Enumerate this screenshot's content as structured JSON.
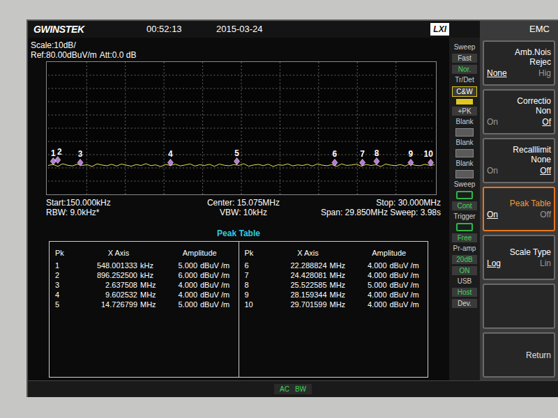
{
  "header": {
    "brand": "GWINSTEK",
    "time": "00:52:13",
    "date": "2015-03-24",
    "lxi": "LXI",
    "mode": "EMC"
  },
  "settings": {
    "scale": "Scale:10dB/",
    "ref": "Ref:80.00dBuV/m",
    "att": "Att:0.0 dB",
    "start": "Start:150.000kHz",
    "center": "Center: 15.075MHz",
    "stop": "Stop: 30.000MHz",
    "rbw": "RBW: 9.0kHz*",
    "vbw": "VBW: 10kHz",
    "span": "Span: 29.850MHz",
    "sweep": "Sweep: 3.98s"
  },
  "chart": {
    "ref_level": 80,
    "div_db": 10,
    "divisions": 10,
    "start_mhz": 0.15,
    "stop_mhz": 30,
    "trace_color": "#e6e65a",
    "marker_color": "#b77ad6",
    "trace": [
      1.8,
      2.6,
      1.2,
      3.1,
      2.0,
      1.5,
      2.8,
      1.9,
      2.4,
      1.1,
      3.0,
      2.2,
      1.6,
      2.7,
      1.4,
      2.9,
      2.1,
      1.3,
      2.5,
      1.8,
      3.2,
      1.7,
      2.3,
      1.0,
      2.6,
      1.9,
      2.8,
      1.5,
      2.2,
      3.0,
      1.4,
      2.4,
      1.8,
      2.7,
      1.2,
      2.9,
      2.0,
      1.6,
      2.5,
      1.9,
      3.1,
      1.3,
      2.2,
      2.6,
      1.7,
      2.8,
      1.1,
      2.4,
      2.0,
      3.0,
      1.5,
      2.3,
      1.8,
      2.7,
      1.4,
      2.9,
      2.1,
      1.6,
      2.5,
      1.2,
      3.0,
      1.9,
      2.2,
      2.8,
      1.3,
      2.6,
      1.8,
      2.4,
      1.0,
      2.9,
      2.1,
      1.7,
      2.5,
      1.4,
      3.1,
      2.0,
      1.6,
      2.7,
      1.9,
      2.3
    ]
  },
  "status_column": [
    {
      "kind": "label",
      "text": "Sweep"
    },
    {
      "kind": "value",
      "text": "Fast",
      "selected": false
    },
    {
      "kind": "value",
      "text": "Nor.",
      "selected": true
    },
    {
      "kind": "label",
      "text": "Tr/Det"
    },
    {
      "kind": "badge",
      "text": "C&W",
      "color": "#e0c820"
    },
    {
      "kind": "swatch",
      "color": "#e0c820"
    },
    {
      "kind": "value",
      "text": "+PK",
      "selected": false
    },
    {
      "kind": "label",
      "text": "Blank"
    },
    {
      "kind": "box"
    },
    {
      "kind": "label",
      "text": "Blank"
    },
    {
      "kind": "box"
    },
    {
      "kind": "label",
      "text": "Blank"
    },
    {
      "kind": "box"
    },
    {
      "kind": "label",
      "text": "Sweep"
    },
    {
      "kind": "icon",
      "color": "#2fb54a"
    },
    {
      "kind": "value",
      "text": "Cont",
      "selected": true
    },
    {
      "kind": "label",
      "text": "Trigger"
    },
    {
      "kind": "icon",
      "color": "#2fb54a"
    },
    {
      "kind": "value",
      "text": "Free",
      "selected": true
    },
    {
      "kind": "label",
      "text": "Pr-amp"
    },
    {
      "kind": "value",
      "text": "20dB",
      "selected": true
    },
    {
      "kind": "value",
      "text": "ON",
      "selected": true
    },
    {
      "kind": "label",
      "text": "USB"
    },
    {
      "kind": "value",
      "text": "Host",
      "selected": true
    },
    {
      "kind": "value",
      "text": "Dev.",
      "selected": false
    }
  ],
  "softkeys": [
    {
      "kind": "choice",
      "title": "Amb.Nois",
      "subtitle": "Rejec",
      "highlighted": false,
      "options": [
        {
          "label": "None",
          "selected": true
        },
        {
          "label": "Hig",
          "selected": false
        }
      ]
    },
    {
      "kind": "choice",
      "title": "Correctio",
      "subtitle": "Non",
      "highlighted": false,
      "options": [
        {
          "label": "On",
          "selected": false
        },
        {
          "label": "Of",
          "selected": true
        }
      ]
    },
    {
      "kind": "choice",
      "title": "Recalllimit",
      "subtitle": "None",
      "highlighted": false,
      "options": [
        {
          "label": "On",
          "selected": false
        },
        {
          "label": "Off",
          "selected": true
        }
      ]
    },
    {
      "kind": "choice",
      "title": "Peak Table",
      "subtitle": "",
      "highlighted": true,
      "options": [
        {
          "label": "On",
          "selected": true
        },
        {
          "label": "Off",
          "selected": false
        }
      ]
    },
    {
      "kind": "choice",
      "title": "Scale Type",
      "subtitle": "",
      "highlighted": false,
      "options": [
        {
          "label": "Log",
          "selected": true
        },
        {
          "label": "Lin",
          "selected": false
        }
      ]
    },
    {
      "kind": "blank",
      "highlighted": false
    },
    {
      "kind": "action",
      "title": "Return",
      "highlighted": false
    }
  ],
  "peak_table": {
    "title": "Peak Table",
    "columns": {
      "pk": "Pk",
      "x": "X Axis",
      "amp": "Amplitude"
    },
    "rows": [
      {
        "pk": "1",
        "freq": "548.001333",
        "freq_unit": "kHz",
        "amp": "5.000",
        "amp_unit": "dBuV /m"
      },
      {
        "pk": "2",
        "freq": "896.252500",
        "freq_unit": "kHz",
        "amp": "6.000",
        "amp_unit": "dBuV /m"
      },
      {
        "pk": "3",
        "freq": "2.637508",
        "freq_unit": "MHz",
        "amp": "4.000",
        "amp_unit": "dBuV /m"
      },
      {
        "pk": "4",
        "freq": "9.602532",
        "freq_unit": "MHz",
        "amp": "4.000",
        "amp_unit": "dBuV /m"
      },
      {
        "pk": "5",
        "freq": "14.726799",
        "freq_unit": "MHz",
        "amp": "5.000",
        "amp_unit": "dBuV /m"
      },
      {
        "pk": "6",
        "freq": "22.288824",
        "freq_unit": "MHz",
        "amp": "4.000",
        "amp_unit": "dBuV /m"
      },
      {
        "pk": "7",
        "freq": "24.428081",
        "freq_unit": "MHz",
        "amp": "4.000",
        "amp_unit": "dBuV /m"
      },
      {
        "pk": "8",
        "freq": "25.522585",
        "freq_unit": "MHz",
        "amp": "5.000",
        "amp_unit": "dBuV /m"
      },
      {
        "pk": "9",
        "freq": "28.159344",
        "freq_unit": "MHz",
        "amp": "4.000",
        "amp_unit": "dBuV /m"
      },
      {
        "pk": "10",
        "freq": "29.701599",
        "freq_unit": "MHz",
        "amp": "4.000",
        "amp_unit": "dBuV /m"
      }
    ]
  },
  "footer": [
    "AC",
    "BW"
  ]
}
